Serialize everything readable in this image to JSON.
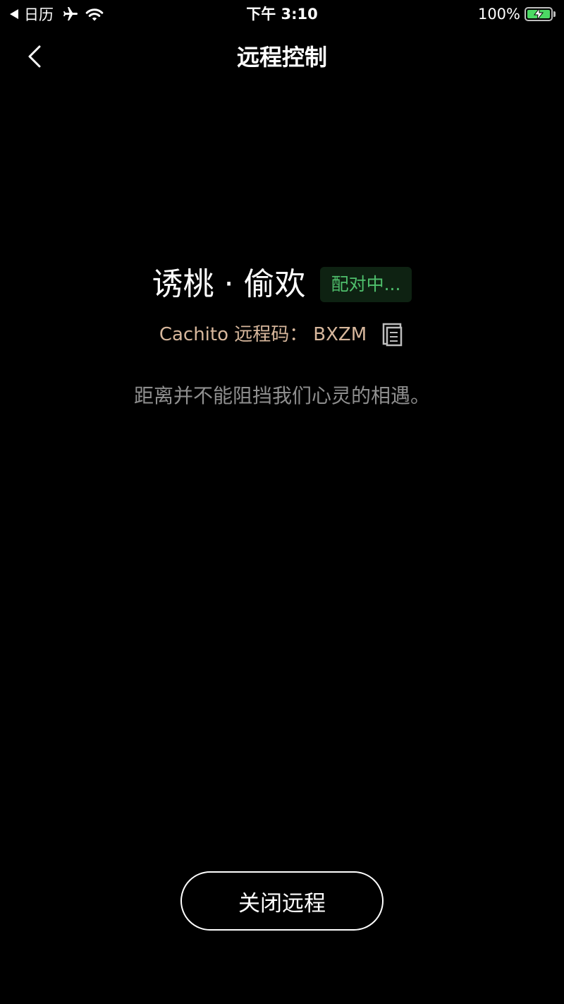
{
  "status_bar": {
    "back_app": "日历",
    "time": "下午 3:10",
    "battery_percent": "100%",
    "battery_level": 1.0,
    "battery_color": "#4cd964",
    "icons": [
      "back-arrow-icon",
      "airplane-icon",
      "wifi-icon",
      "battery-charging-icon"
    ]
  },
  "nav": {
    "title": "远程控制",
    "back_icon": "chevron-left-icon"
  },
  "device": {
    "name": "诱桃 · 偷欢",
    "status": "配对中...",
    "status_color": "#4fbf6c"
  },
  "remote_code": {
    "label": "Cachito 远程码：",
    "value": "BXZM",
    "copy_icon": "copy-icon",
    "color": "#d7b79c"
  },
  "slogan": "距离并不能阻挡我们心灵的相遇。",
  "close_button": {
    "label": "关闭远程"
  }
}
